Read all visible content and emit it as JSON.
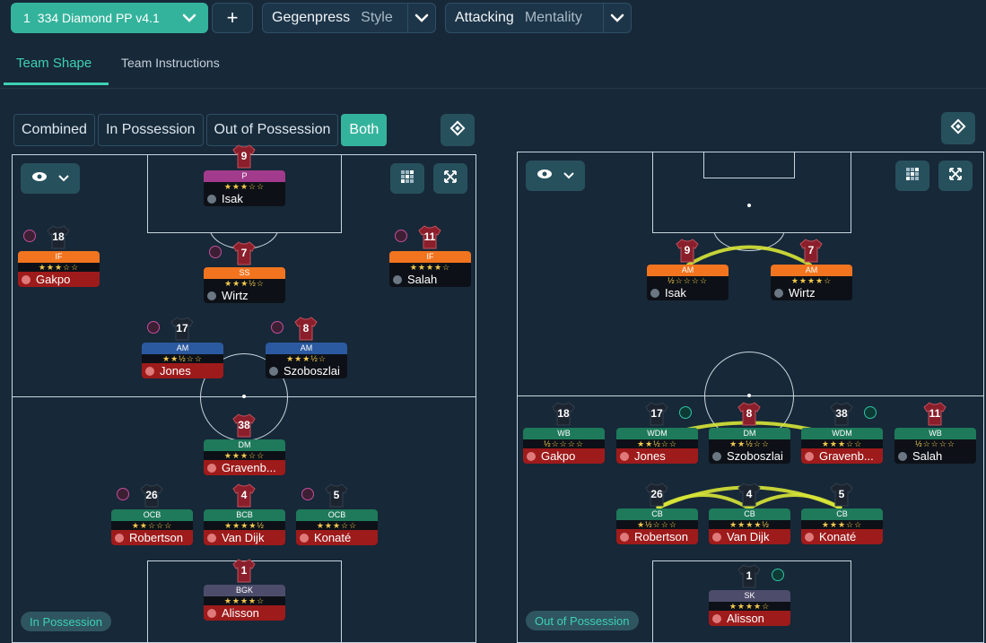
{
  "header": {
    "tactic_slot": "1",
    "tactic_name": "334 Diamond PP v4.1",
    "add_label": "+",
    "style_value": "Gegenpress",
    "style_key": "Style",
    "mentality_value": "Attacking",
    "mentality_key": "Mentality"
  },
  "tabs": [
    {
      "label": "Team Shape"
    },
    {
      "label": "Team Instructions"
    }
  ],
  "modes": [
    {
      "label": "Combined"
    },
    {
      "label": "In Possession"
    },
    {
      "label": "Out of Possession"
    },
    {
      "label": "Both"
    }
  ],
  "phase_labels": {
    "left": "In Possession",
    "right": "Out of Possession"
  },
  "left_players": [
    {
      "num": "9",
      "role": "P",
      "stars": "★★★☆☆",
      "name": "Isak",
      "role_color": "purple",
      "name_color": "black"
    },
    {
      "num": "18",
      "role": "IF",
      "stars": "★★★☆☆",
      "name": "Gakpo",
      "role_color": "orange",
      "name_color": "red"
    },
    {
      "num": "7",
      "role": "SS",
      "stars": "★★★½☆",
      "name": "Wirtz",
      "role_color": "orange",
      "name_color": "black"
    },
    {
      "num": "11",
      "role": "IF",
      "stars": "★★★★☆",
      "name": "Salah",
      "role_color": "orange",
      "name_color": "black"
    },
    {
      "num": "17",
      "role": "AM",
      "stars": "★★½☆☆",
      "name": "Jones",
      "role_color": "blue",
      "name_color": "red"
    },
    {
      "num": "8",
      "role": "AM",
      "stars": "★★★½☆",
      "name": "Szoboszlai",
      "role_color": "blue",
      "name_color": "black"
    },
    {
      "num": "38",
      "role": "DM",
      "stars": "★★★☆☆",
      "name": "Gravenb...",
      "role_color": "green",
      "name_color": "red"
    },
    {
      "num": "26",
      "role": "OCB",
      "stars": "★★☆☆☆",
      "name": "Robertson",
      "role_color": "green",
      "name_color": "red"
    },
    {
      "num": "4",
      "role": "BCB",
      "stars": "★★★★½",
      "name": "Van Dijk",
      "role_color": "green",
      "name_color": "red"
    },
    {
      "num": "5",
      "role": "OCB",
      "stars": "★★★☆☆",
      "name": "Konaté",
      "role_color": "green",
      "name_color": "red"
    },
    {
      "num": "1",
      "role": "BGK",
      "stars": "★★★★☆",
      "name": "Alisson",
      "role_color": "grey",
      "name_color": "red"
    }
  ],
  "right_players": [
    {
      "num": "9",
      "role": "AM",
      "stars": "½☆☆☆☆",
      "name": "Isak",
      "role_color": "orange",
      "name_color": "black"
    },
    {
      "num": "7",
      "role": "AM",
      "stars": "★★★★☆",
      "name": "Wirtz",
      "role_color": "orange",
      "name_color": "black"
    },
    {
      "num": "18",
      "role": "WB",
      "stars": "½☆☆☆☆",
      "name": "Gakpo",
      "role_color": "green",
      "name_color": "red"
    },
    {
      "num": "17",
      "role": "WDM",
      "stars": "★★½☆☆",
      "name": "Jones",
      "role_color": "green",
      "name_color": "red"
    },
    {
      "num": "8",
      "role": "DM",
      "stars": "★★½☆☆",
      "name": "Szoboszlai",
      "role_color": "green",
      "name_color": "black"
    },
    {
      "num": "38",
      "role": "WDM",
      "stars": "★★★☆☆",
      "name": "Gravenb...",
      "role_color": "green",
      "name_color": "red"
    },
    {
      "num": "11",
      "role": "WB",
      "stars": "½☆☆☆☆",
      "name": "Salah",
      "role_color": "green",
      "name_color": "black"
    },
    {
      "num": "26",
      "role": "CB",
      "stars": "★½☆☆☆",
      "name": "Robertson",
      "role_color": "green",
      "name_color": "red"
    },
    {
      "num": "4",
      "role": "CB",
      "stars": "★★★★½",
      "name": "Van Dijk",
      "role_color": "green",
      "name_color": "red"
    },
    {
      "num": "5",
      "role": "CB",
      "stars": "★★★☆☆",
      "name": "Konaté",
      "role_color": "green",
      "name_color": "red"
    },
    {
      "num": "1",
      "role": "SK",
      "stars": "★★★★☆",
      "name": "Alisson",
      "role_color": "grey",
      "name_color": "red"
    }
  ],
  "colors": {
    "accent": "#34b39c",
    "background": "#172838",
    "link_line": "#d8e637"
  }
}
